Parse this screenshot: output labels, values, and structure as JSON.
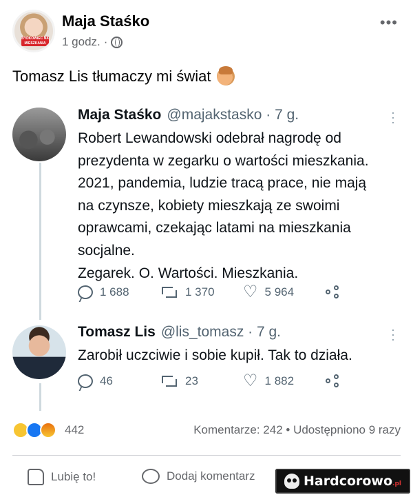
{
  "post": {
    "author": "Maja Staśko",
    "time": "1 godz.",
    "separator": "·",
    "text": "Tomasz Lis tłumaczy mi świat",
    "avatar_badge": "BYDKOWIEC NA MIESZKANIA",
    "reactions": [
      "haha",
      "like",
      "angry"
    ],
    "reaction_count": "442",
    "stats": "Komentarze: 242 • Udostępniono 9 razy",
    "like_label": "Lubię to!",
    "comment_label": "Dodaj komentarz"
  },
  "tweets": [
    {
      "author": "Maja Staśko",
      "handle": "@majakstasko · 7 g.",
      "lines": [
        "Robert Lewandowski odebrał nagrodę od",
        "prezydenta w zegarku o wartości mieszkania.",
        "2021, pandemia, ludzie tracą prace, nie mają",
        "na czynsze, kobiety mieszkają ze swoimi",
        "oprawcami, czekając latami na mieszkania",
        "socjalne.",
        "Zegarek. O. Wartości. Mieszkania."
      ],
      "replies": "1 688",
      "retweets": "1 370",
      "likes": "5 964"
    },
    {
      "author": "Tomasz Lis",
      "handle": "@lis_tomasz · 7 g.",
      "lines": [
        "Zarobił uczciwie i sobie kupił. Tak to działa."
      ],
      "replies": "46",
      "retweets": "23",
      "likes": "1 882"
    }
  ],
  "watermark": {
    "text": "Hardcorowo",
    "suffix": ".pl"
  }
}
